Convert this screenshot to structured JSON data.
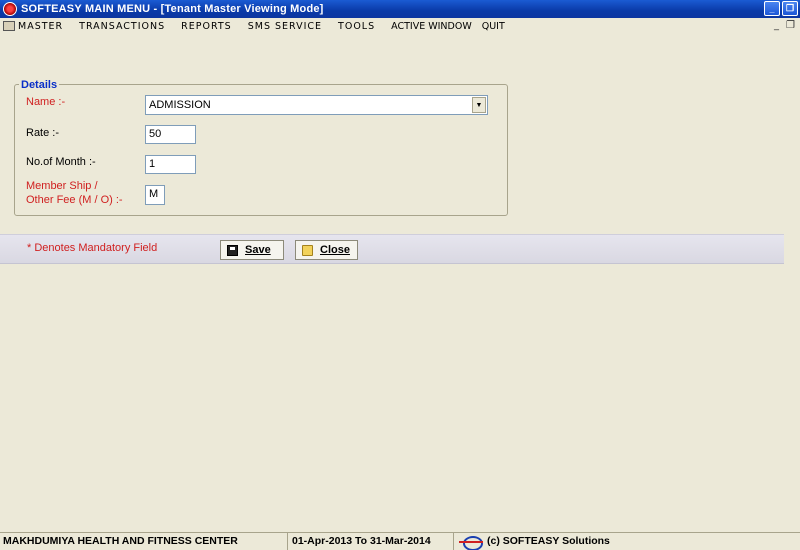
{
  "window": {
    "title": "SOFTEASY MAIN MENU - [Tenant Master Viewing Mode]",
    "minimize_glyph": "_",
    "restore_glyph": "❐",
    "mdi_minimize_glyph": "_",
    "mdi_restore_glyph": "❐"
  },
  "menu": {
    "items": [
      "MASTER",
      "TRANSACTIONS",
      "REPORTS",
      "SMS SERVICE",
      "TOOLS",
      "ACTIVE WINDOW",
      "QUIT"
    ]
  },
  "form": {
    "group_title": "Details",
    "name_label": "Name :-",
    "name_value": "ADMISSION",
    "rate_label": "Rate :-",
    "rate_value": "50",
    "months_label": "No.of Month :-",
    "months_value": "1",
    "membership_label_line1": "Member Ship /",
    "membership_label_line2": "Other Fee (M / O) :-",
    "membership_value": "M"
  },
  "actions": {
    "mandatory_note": "* Denotes Mandatory Field",
    "save_label": "Save",
    "close_label": "Close"
  },
  "status": {
    "company": "MAKHDUMIYA HEALTH AND FITNESS CENTER",
    "period": "01-Apr-2013 To 31-Mar-2014",
    "vendor": "(c) SOFTEASY Solutions"
  },
  "colors": {
    "titlebar": "#0a3aa8",
    "background": "#ece9d8",
    "required_label": "#d02020",
    "group_title": "#0a2fc8"
  }
}
